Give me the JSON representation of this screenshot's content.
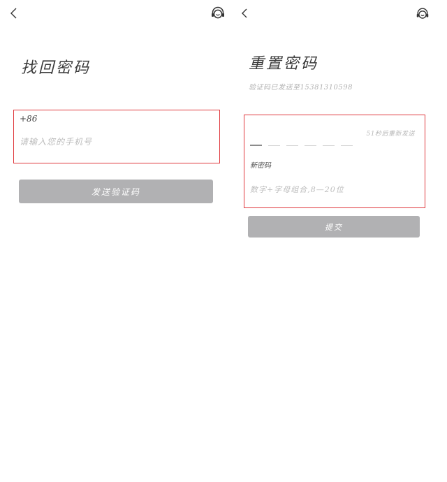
{
  "left": {
    "title": "找回密码",
    "country_code": "+86",
    "phone_placeholder": "请输入您的手机号",
    "send_code_button": "发送验证码"
  },
  "right": {
    "title": "重置密码",
    "subtitle": "验证码已发送至15381310598",
    "resend_timer": "51秒后重新发送",
    "code_slots": 6,
    "new_password_label": "新密码",
    "new_password_placeholder": "数字+字母组合,8—20位",
    "submit_button": "提交"
  },
  "icons": {
    "back": "chevron-left-icon",
    "support": "headset-icon"
  },
  "colors": {
    "highlight_border": "#e0393e",
    "button_bg": "#b1b1b3",
    "placeholder": "#bdbdbd"
  }
}
